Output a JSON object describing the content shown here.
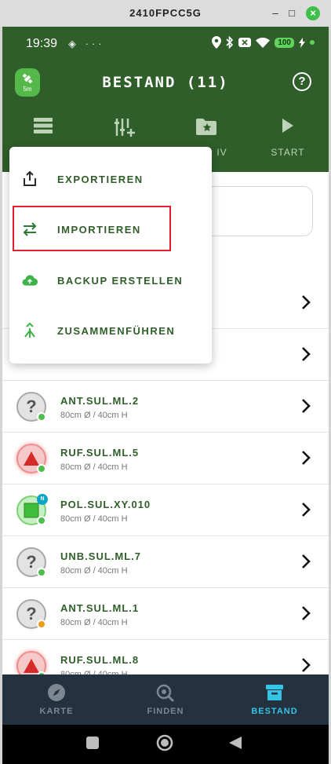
{
  "window": {
    "title": "2410FPCC5G"
  },
  "statusbar": {
    "time": "19:39",
    "battery": "100"
  },
  "appbar": {
    "gps_label": "5m",
    "title": "BESTAND (11)",
    "help_label": "?"
  },
  "tabs": [
    {
      "label": "",
      "icon": "list-icon"
    },
    {
      "label": "",
      "icon": "add-filter-icon"
    },
    {
      "label": "IV",
      "icon": "folder-star-icon"
    },
    {
      "label": "START",
      "icon": "play-icon"
    }
  ],
  "menu": {
    "items": [
      {
        "label": "EXPORTIEREN",
        "icon": "export-icon"
      },
      {
        "label": "IMPORTIEREN",
        "icon": "import-arrows-icon"
      },
      {
        "label": "BACKUP ERSTELLEN",
        "icon": "cloud-upload-icon"
      },
      {
        "label": "ZUSAMMENFÜHREN",
        "icon": "merge-icon"
      }
    ]
  },
  "list": {
    "rows": [
      {
        "name": "ANT.SUL.ML.2",
        "dims": "80cm Ø / 40cm H",
        "shape": "question",
        "status_color": "#4bbf4a"
      },
      {
        "name": "RUF.SUL.ML.5",
        "dims": "80cm Ø / 40cm H",
        "shape": "triangle",
        "status_color": "#4bbf4a"
      },
      {
        "name": "POL.SUL.XY.010",
        "dims": "80cm Ø / 40cm H",
        "shape": "square",
        "status_color": "#4bbf4a",
        "badge": "N"
      },
      {
        "name": "UNB.SUL.ML.7",
        "dims": "80cm Ø / 40cm H",
        "shape": "question",
        "status_color": "#4bbf4a"
      },
      {
        "name": "ANT.SUL.ML.1",
        "dims": "80cm Ø / 40cm H",
        "shape": "question",
        "status_color": "#f19a16"
      },
      {
        "name": "RUF.SUL.ML.8",
        "dims": "80cm Ø / 40cm H",
        "shape": "triangle",
        "status_color": "#4bbf4a"
      }
    ]
  },
  "bottomnav": {
    "items": [
      {
        "label": "KARTE",
        "active": false
      },
      {
        "label": "FINDEN",
        "active": false
      },
      {
        "label": "BESTAND",
        "active": true
      }
    ]
  },
  "colors": {
    "primary": "#2f5e2a",
    "accent": "#5fd35c",
    "active_nav": "#35c3e6",
    "highlight": "#e0202a"
  }
}
